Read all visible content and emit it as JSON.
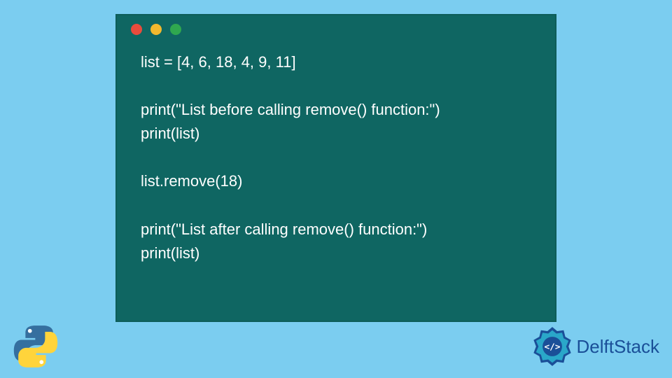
{
  "window": {
    "dots": {
      "red": "#e94b3c",
      "yellow": "#f2b82e",
      "green": "#2fa84f"
    }
  },
  "code": {
    "lines": [
      "list = [4, 6, 18, 4, 9, 11]",
      "",
      "print(\"List before calling remove() function:\")",
      "print(list)",
      "",
      "list.remove(18)",
      "",
      "print(\"List after calling remove() function:\")",
      "print(list)"
    ]
  },
  "brand": {
    "name": "DelftStack"
  },
  "logos": {
    "python": "python-logo",
    "delft": "delftstack-logo"
  }
}
